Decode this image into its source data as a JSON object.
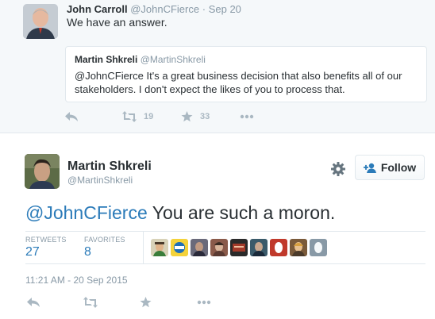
{
  "parent_tweet": {
    "author_name": "John Carroll",
    "author_handle": "@JohnCFierce",
    "separator": "·",
    "date": "Sep 20",
    "text": "We have an answer.",
    "quoted": {
      "author_name": "Martin Shkreli",
      "author_handle": "@MartinShkreli",
      "text": "@JohnCFierce It's a great business decision that also benefits all of our stakeholders. I don't expect the likes of you to process that."
    },
    "actions": {
      "retweet_count": "19",
      "favorite_count": "33"
    }
  },
  "main_tweet": {
    "author_name": "Martin Shkreli",
    "author_handle": "@MartinShkreli",
    "follow_label": "Follow",
    "mention": "@JohnCFierce",
    "text": " You are such a moron.",
    "stats": {
      "retweets_label": "RETWEETS",
      "retweets_value": "27",
      "favorites_label": "FAVORITES",
      "favorites_value": "8"
    },
    "timestamp": "11:21 AM - 20 Sep 2015"
  },
  "colors": {
    "link": "#2b7bb9",
    "muted": "#8899a6",
    "icon": "#aab8c2",
    "border": "#e1e8ed"
  }
}
